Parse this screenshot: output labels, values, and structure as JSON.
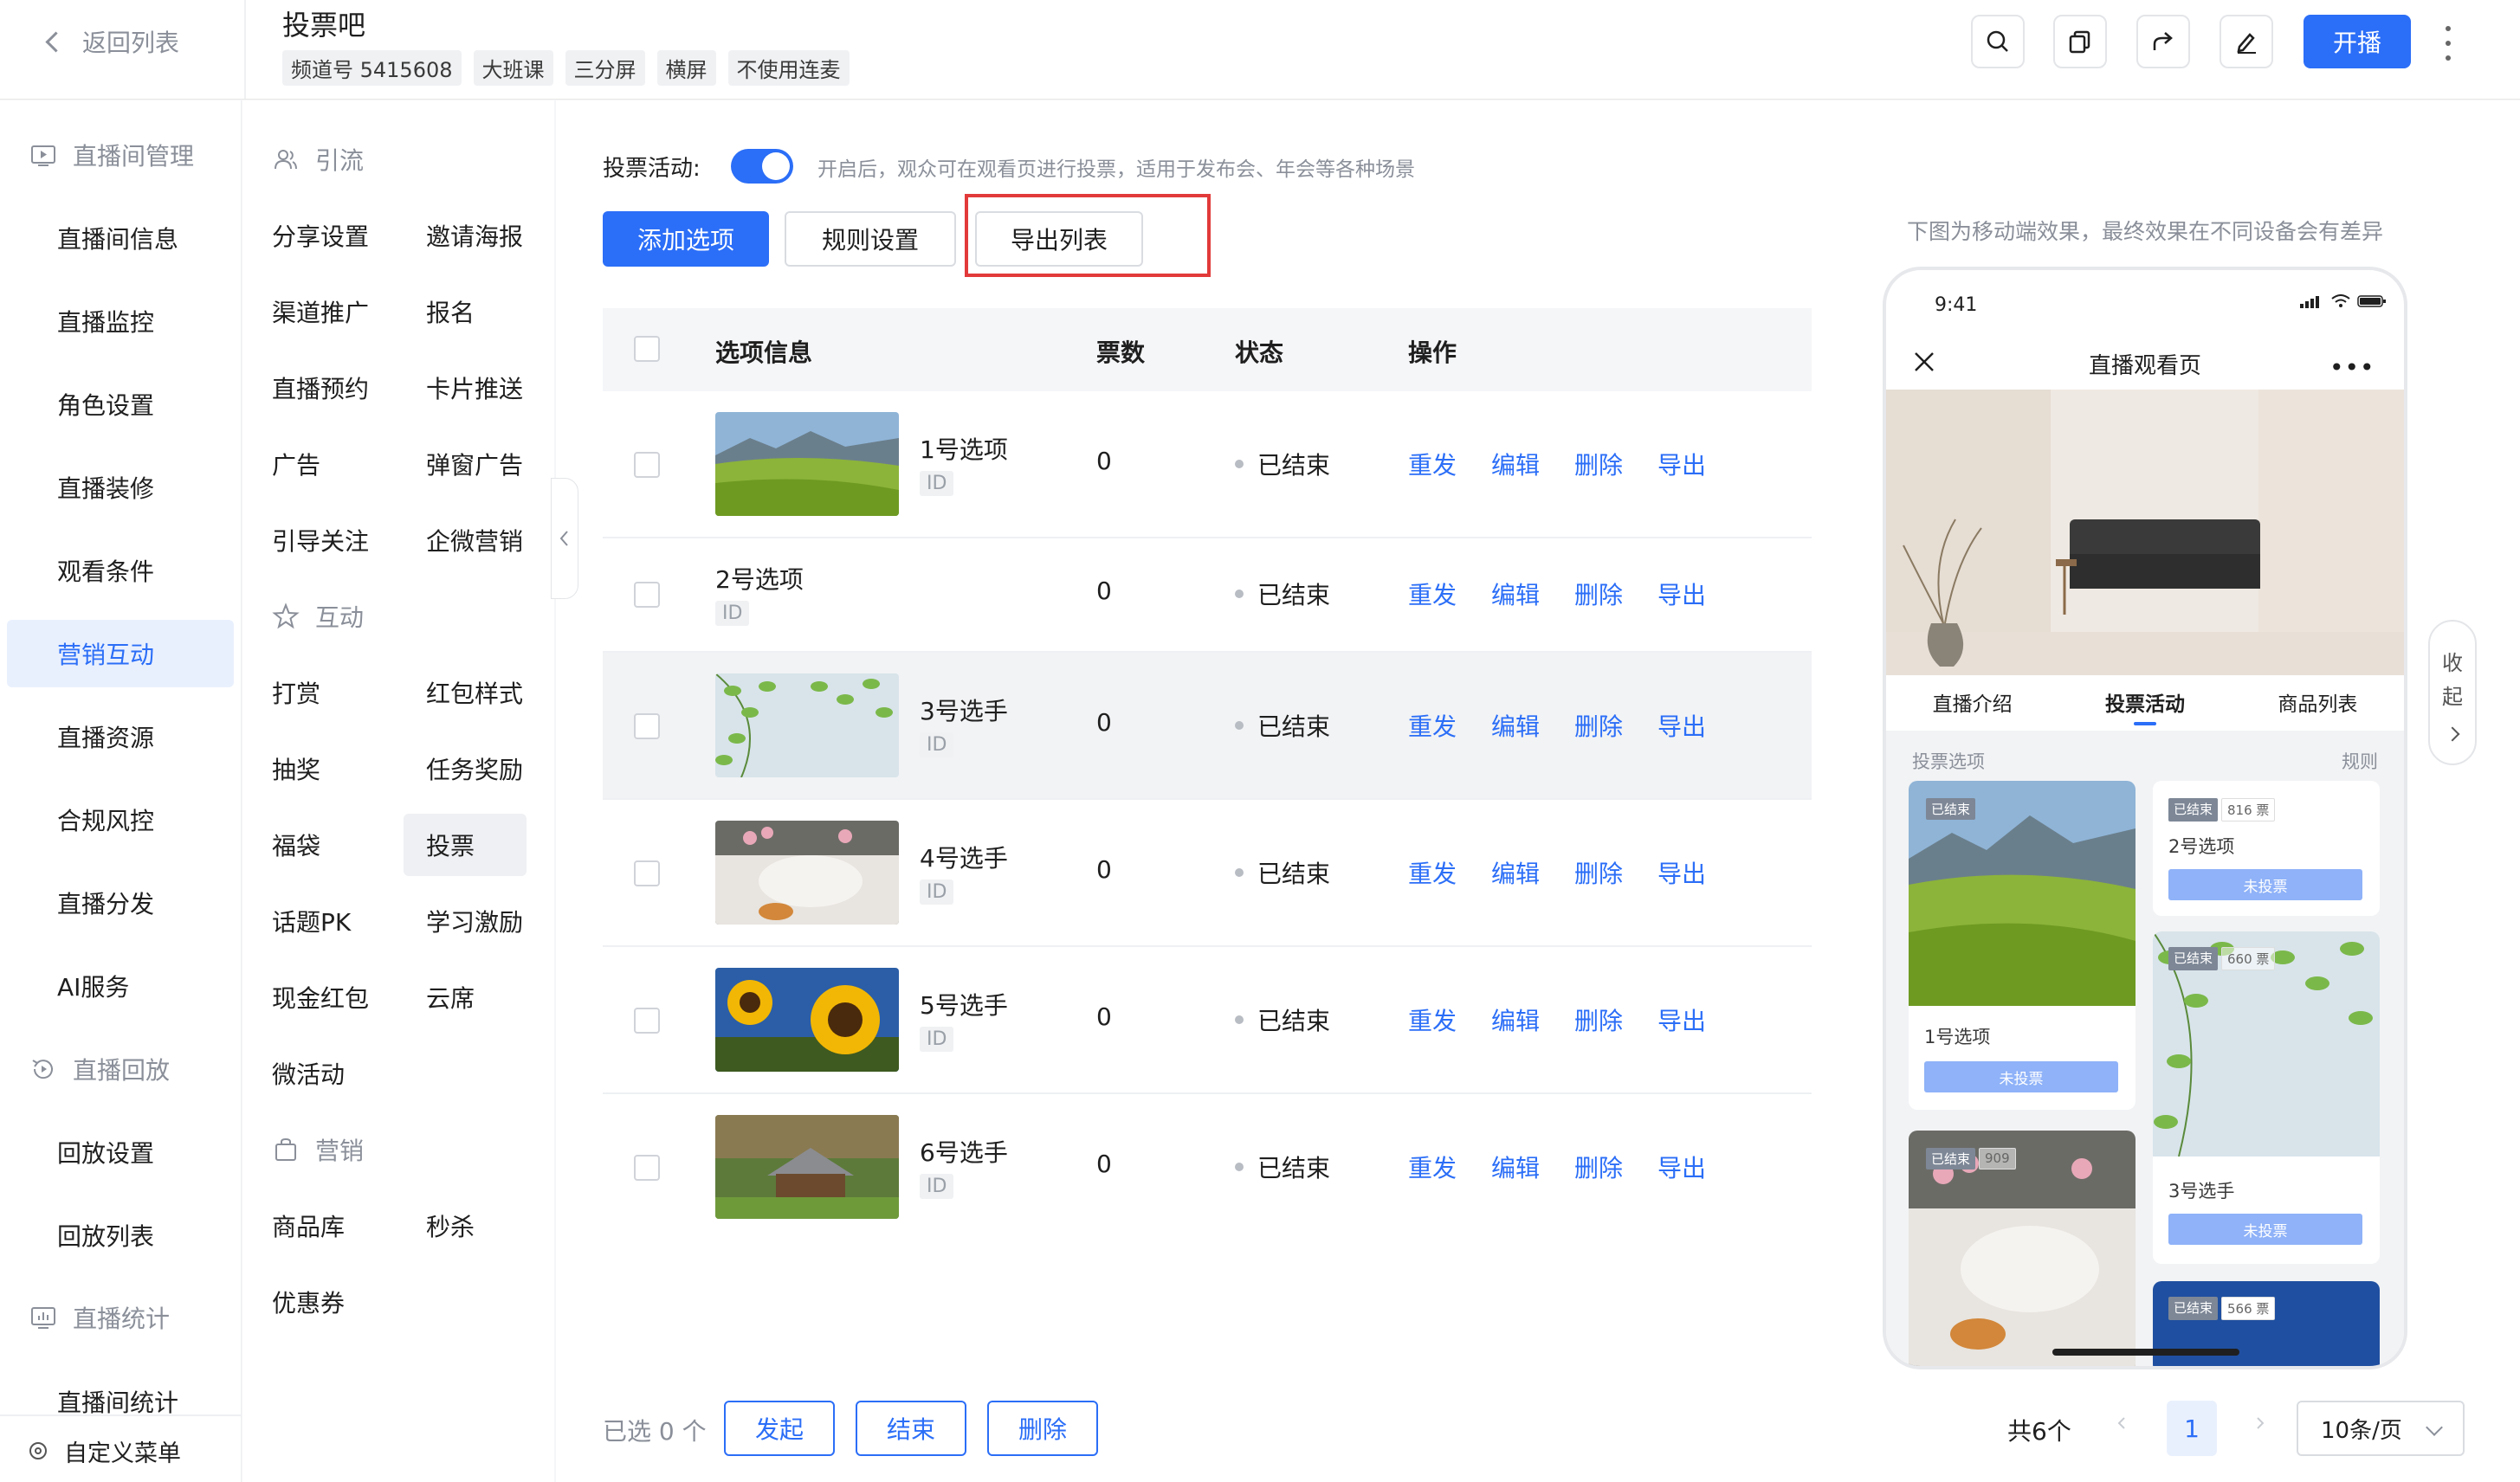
{
  "header": {
    "back_label": "返回列表",
    "title": "投票吧",
    "tags": [
      "频道号 5415608",
      "大班课",
      "三分屏",
      "横屏",
      "不使用连麦"
    ],
    "tools": [
      "search-icon",
      "copy-icon",
      "share-icon",
      "edit-icon"
    ],
    "live_button": "开播"
  },
  "nav1": {
    "groups": [
      {
        "label": "直播间管理",
        "icon": "play-screen-icon",
        "items": [
          "直播间信息",
          "直播监控",
          "角色设置",
          "直播装修",
          "观看条件",
          "营销互动",
          "直播资源",
          "合规风控",
          "直播分发",
          "AI服务"
        ]
      },
      {
        "label": "直播回放",
        "icon": "replay-icon",
        "items": [
          "回放设置",
          "回放列表"
        ]
      },
      {
        "label": "直播统计",
        "icon": "stats-icon",
        "items": [
          "直播间统计"
        ]
      }
    ],
    "active": "营销互动",
    "bottom": "自定义菜单"
  },
  "nav2": {
    "group1": "引流",
    "group1_items": [
      [
        "分享设置",
        "邀请海报"
      ],
      [
        "渠道推广",
        "报名"
      ],
      [
        "直播预约",
        "卡片推送"
      ],
      [
        "广告",
        "弹窗广告"
      ],
      [
        "引导关注",
        "企微营销"
      ]
    ],
    "group2": "互动",
    "group2_items": [
      [
        "打赏",
        "红包样式"
      ],
      [
        "抽奖",
        "任务奖励"
      ],
      [
        "福袋",
        "投票"
      ],
      [
        "话题PK",
        "学习激励"
      ],
      [
        "现金红包",
        "云席"
      ],
      [
        "微活动",
        ""
      ]
    ],
    "group3": "营销",
    "group3_items": [
      [
        "商品库",
        "秒杀"
      ],
      [
        "优惠券",
        ""
      ]
    ],
    "active": "投票"
  },
  "main": {
    "vote_label": "投票活动:",
    "vote_enabled": true,
    "vote_desc": "开启后，观众可在观看页进行投票，适用于发布会、年会等各种场景",
    "btn_add": "添加选项",
    "btn_rules": "规则设置",
    "btn_export": "导出列表",
    "columns": [
      "选项信息",
      "票数",
      "状态",
      "操作"
    ],
    "rows": [
      {
        "name": "1号选项",
        "id": "ID",
        "votes": "0",
        "status": "已结束",
        "image": "meadow"
      },
      {
        "name": "2号选项",
        "id": "ID",
        "votes": "0",
        "status": "已结束",
        "image": ""
      },
      {
        "name": "3号选手",
        "id": "ID",
        "votes": "0",
        "status": "已结束",
        "image": "leaves"
      },
      {
        "name": "4号选手",
        "id": "ID",
        "votes": "0",
        "status": "已结束",
        "image": "tea"
      },
      {
        "name": "5号选手",
        "id": "ID",
        "votes": "0",
        "status": "已结束",
        "image": "sunflower"
      },
      {
        "name": "6号选手",
        "id": "ID",
        "votes": "0",
        "status": "已结束",
        "image": "cabin"
      }
    ],
    "ops": [
      "重发",
      "编辑",
      "删除",
      "导出"
    ],
    "footer": {
      "selected": "已选 0 个",
      "btn_start": "发起",
      "btn_end": "结束",
      "btn_delete": "删除",
      "total": "共6个",
      "page": "1",
      "page_size": "10条/页"
    }
  },
  "preview": {
    "note": "下图为移动端效果，最终效果在不同设备会有差异",
    "time": "9:41",
    "title": "直播观看页",
    "tabs": [
      "直播介绍",
      "投票活动",
      "商品列表"
    ],
    "active_tab": "投票活动",
    "section": "投票选项",
    "rule": "规则",
    "cards": [
      {
        "name": "1号选项",
        "status": "已结束",
        "count": "",
        "button": "未投票"
      },
      {
        "name": "2号选项",
        "status": "已结束",
        "count": "816 票",
        "button": "未投票"
      },
      {
        "name": "3号选手",
        "status": "已结束",
        "count": "660 票",
        "button": "未投票"
      },
      {
        "name": "",
        "status": "已结束",
        "count": "909",
        "button": ""
      },
      {
        "name": "",
        "status": "已结束",
        "count": "566 票",
        "button": ""
      }
    ],
    "collapse_label": [
      "收",
      "起"
    ]
  },
  "colors": {
    "accent": "#2b6ef7",
    "highlight_box": "#e23a3a"
  }
}
